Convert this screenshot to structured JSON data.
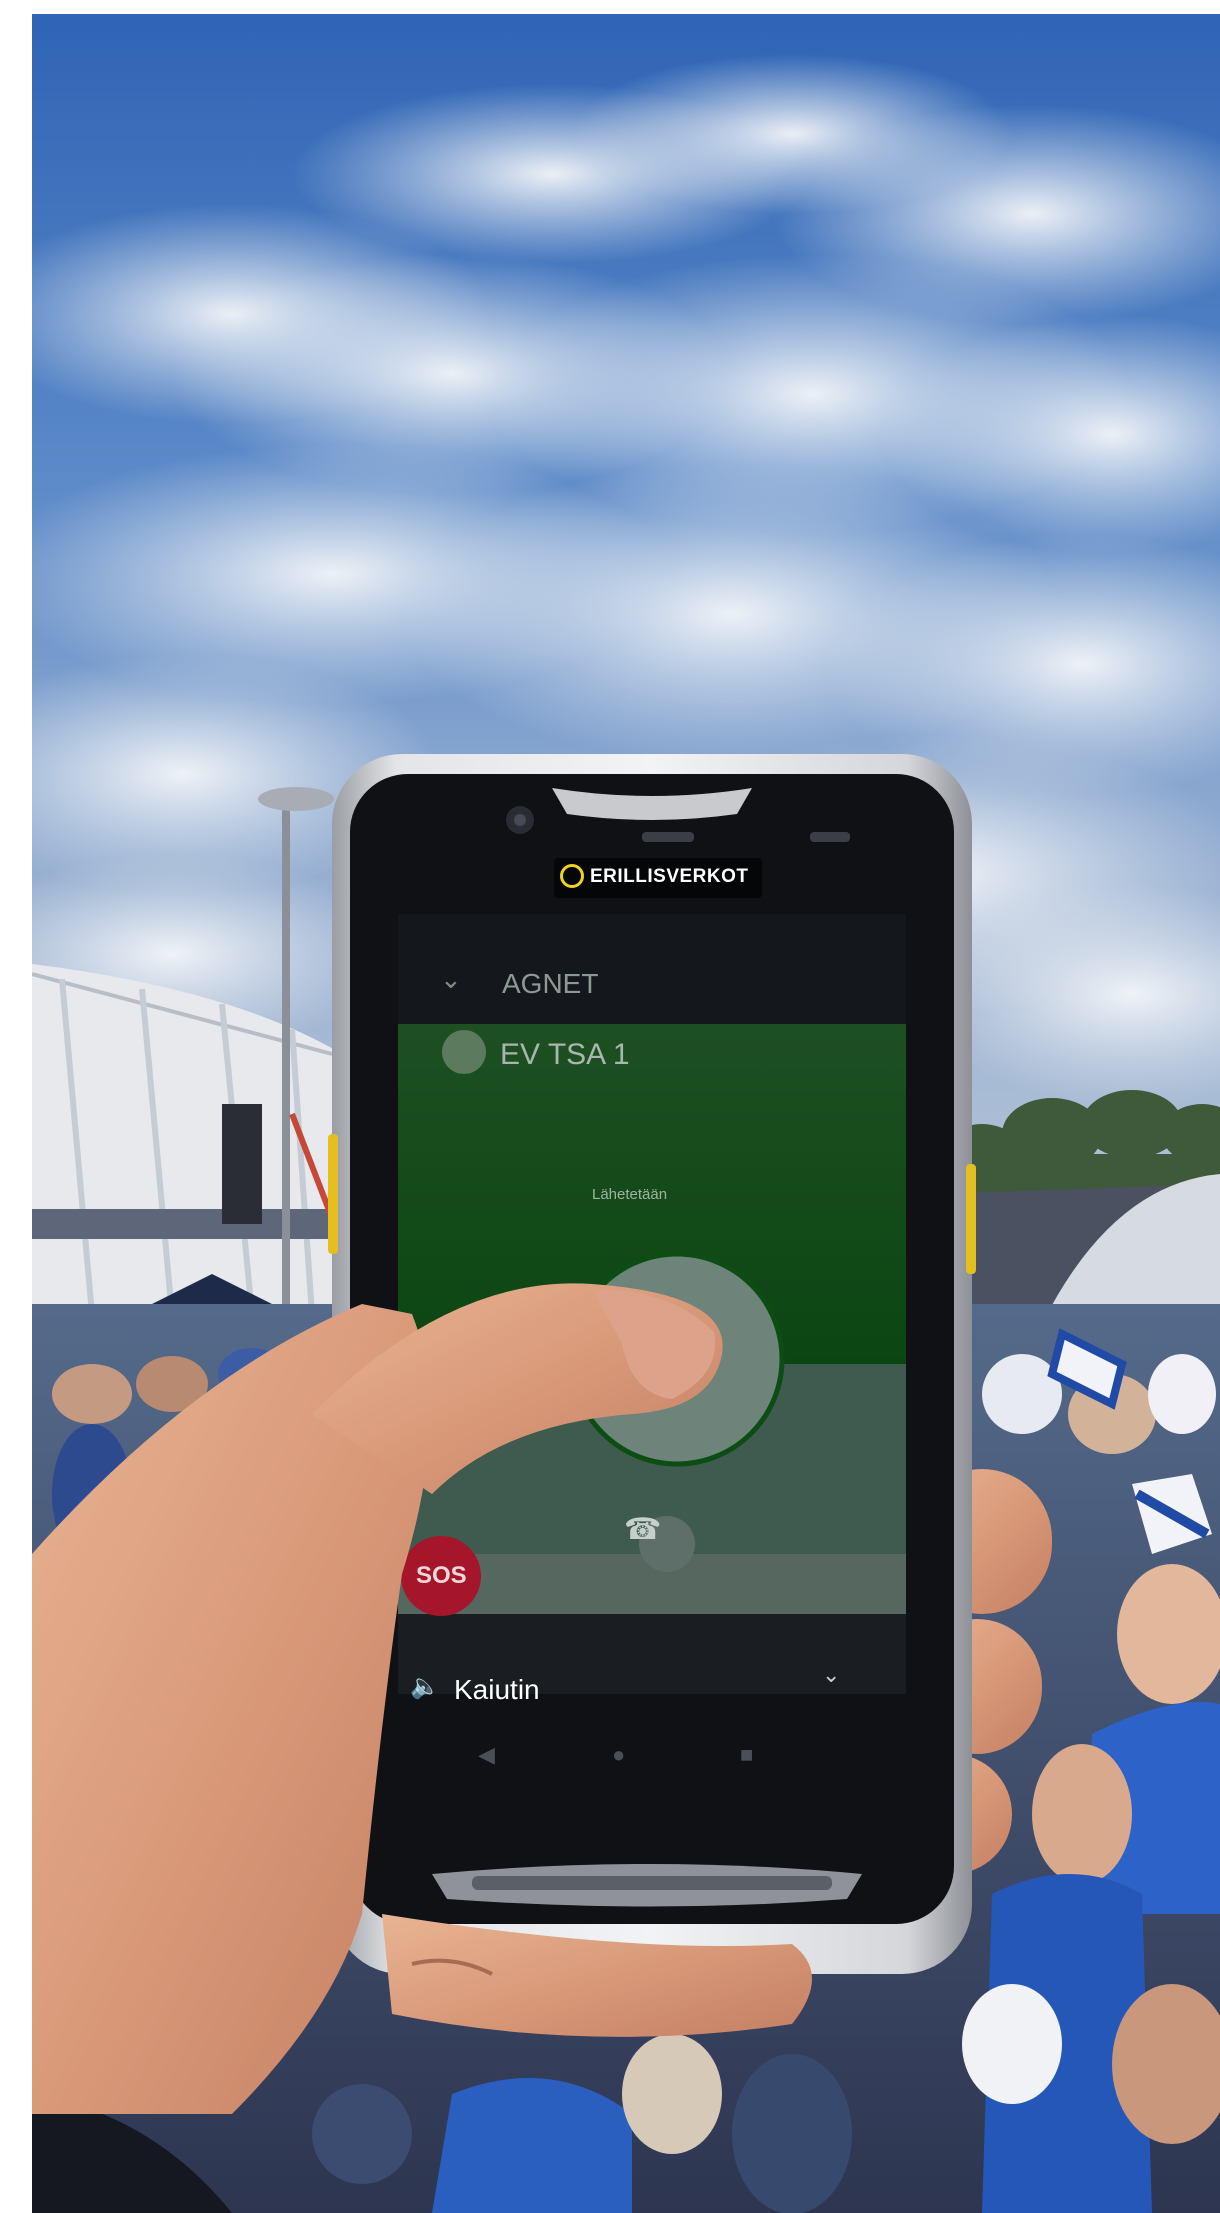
{
  "photo": {
    "brand_label": "ERILLISVERKOT",
    "brand_logo_icon": "erillisverkot-logo-icon",
    "phone_screen": {
      "header": {
        "back_icon": "chevron-down-icon",
        "title": "AGNET"
      },
      "group": {
        "icon": "group-icon",
        "name": "EV TSA 1"
      },
      "ptt": {
        "status_text": "Lähetetään",
        "button_icon": "ptt-circle-icon"
      },
      "end_call_icon": "phone-hangup-icon",
      "sos_label": "SOS",
      "audio": {
        "icon": "speaker-icon",
        "label": "Kaiutin",
        "dropdown_icon": "chevron-down-icon"
      },
      "nav": {
        "back_icon": "nav-back-icon",
        "home_icon": "nav-home-icon",
        "recents_icon": "nav-recents-icon"
      }
    },
    "colors": {
      "sky": "#3d6fb8",
      "screen_green": "#0f5a18",
      "sos_red": "#a5162a",
      "brand_yellow": "#f2d21c"
    }
  }
}
